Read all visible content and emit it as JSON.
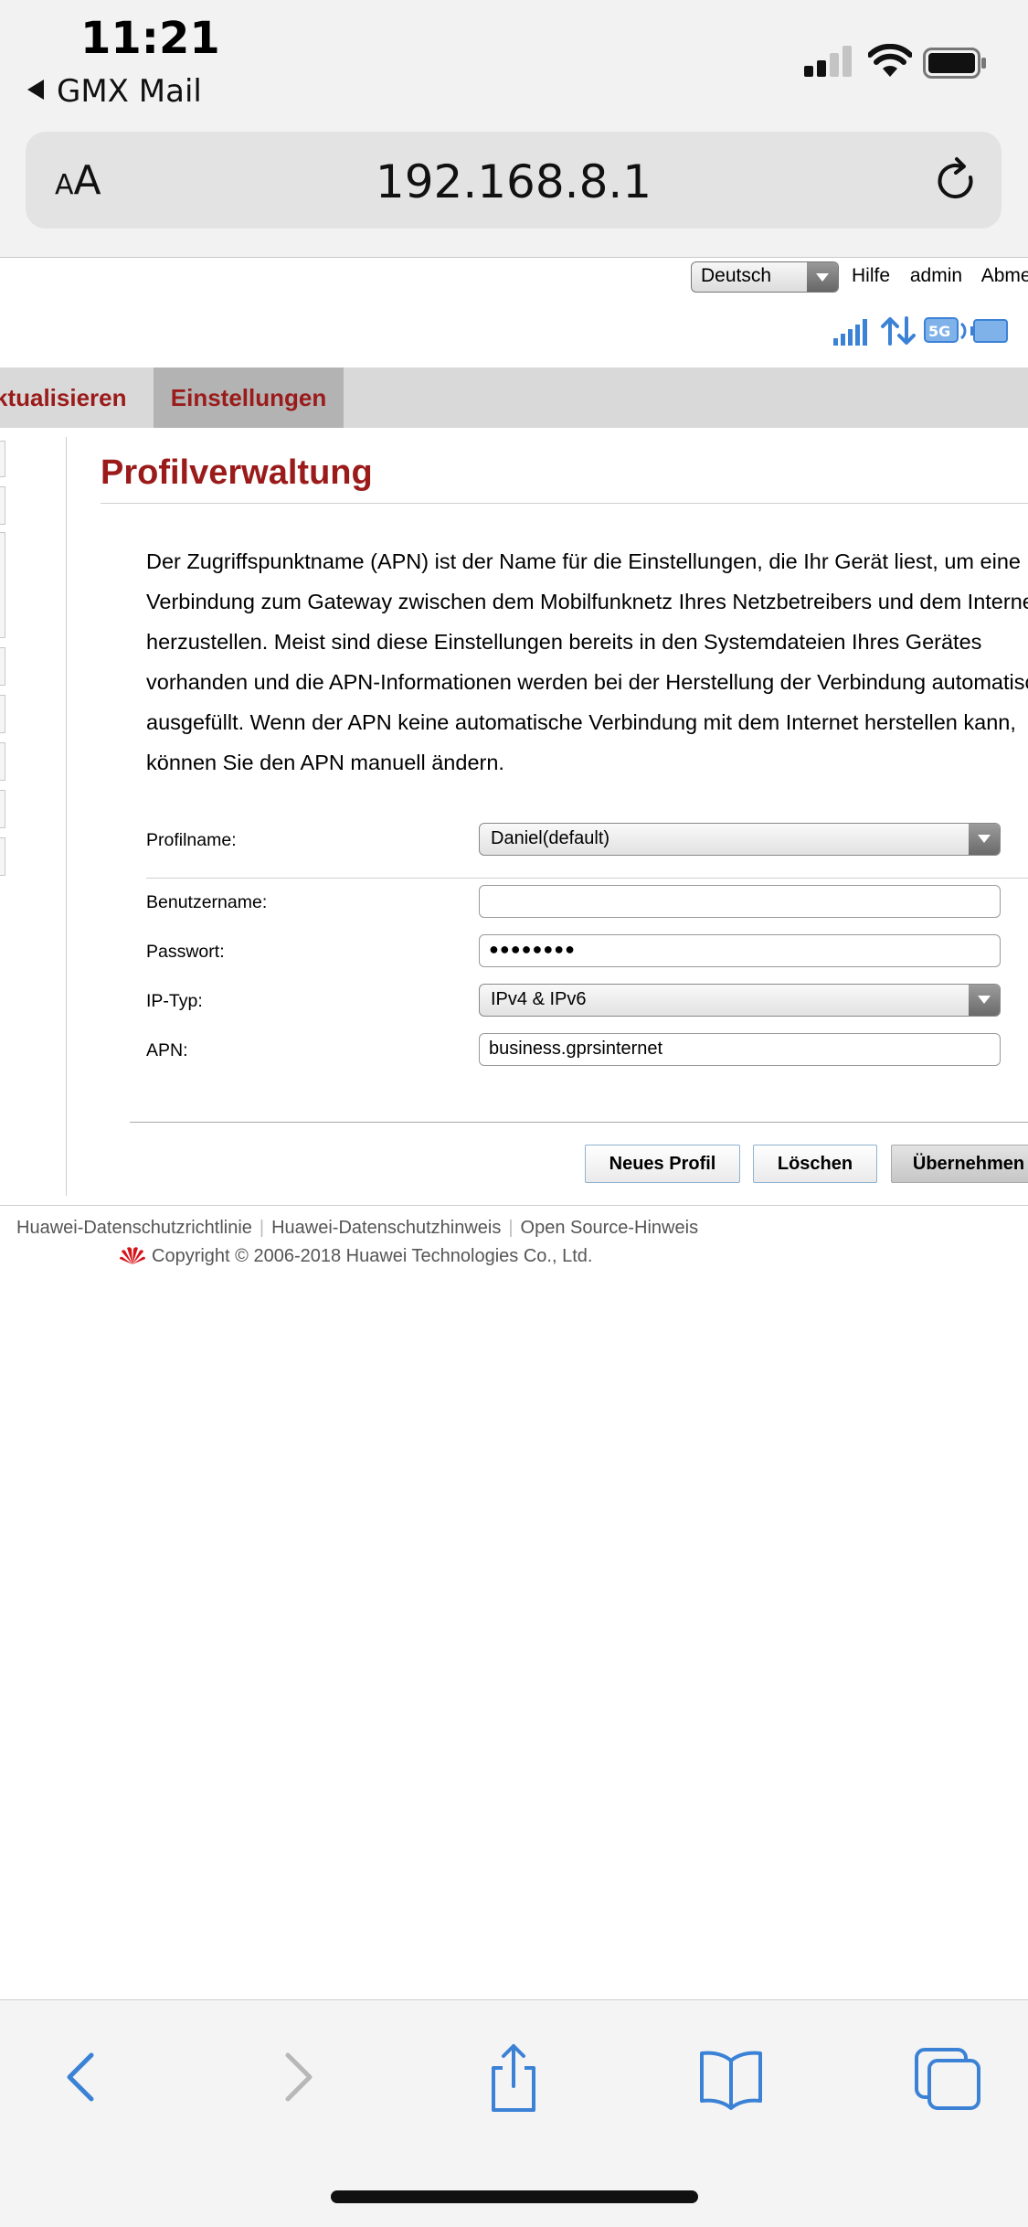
{
  "status_bar": {
    "time": "11:21",
    "back_app": "GMX Mail"
  },
  "safari": {
    "text_size_small": "A",
    "text_size_big": "A",
    "url": "192.168.8.1"
  },
  "router": {
    "language": "Deutsch",
    "top_links": [
      "Hilfe",
      "admin",
      "Abmeldung"
    ],
    "status_icons": [
      "signal-strength-icon",
      "data-transfer-icon",
      "5g-icon",
      "battery-icon"
    ],
    "menu": {
      "update": "ktualisieren",
      "settings": "Einstellungen"
    },
    "title": "Profilverwaltung",
    "description_lines": [
      "Der Zugriffspunktname (APN) ist der Name für die Einstellungen, die Ihr Gerät liest, um eine",
      "Verbindung zum Gateway zwischen dem Mobilfunknetz Ihres Netzbetreibers und dem Internet",
      "herzustellen. Meist sind diese Einstellungen bereits in den Systemdateien Ihres Gerätes",
      "vorhanden und die APN-Informationen werden bei der Herstellung der Verbindung automatisch",
      "ausgefüllt. Wenn der APN keine automatische Verbindung mit dem Internet herstellen kann,",
      "können Sie den APN manuell ändern."
    ],
    "form": {
      "profile_label": "Profilname:",
      "profile_value": "Daniel(default)",
      "username_label": "Benutzername:",
      "username_value": "",
      "password_label": "Passwort:",
      "password_value": "●●●●●●●●",
      "ip_type_label": "IP-Typ:",
      "ip_type_value": "IPv4 & IPv6",
      "apn_label": "APN:",
      "apn_value": "business.gprsinternet"
    },
    "buttons": {
      "new_profile": "Neues Profil",
      "delete": "Löschen",
      "apply": "Übernehmen"
    },
    "footer": {
      "links": [
        "Huawei-Datenschutzrichtlinie",
        "Huawei-Datenschutzhinweis",
        "Open Source-Hinweis"
      ],
      "copyright": "Copyright © 2006-2018 Huawei Technologies Co., Ltd."
    }
  },
  "colors": {
    "brand_red": "#9b1b1b",
    "ios_blue": "#3b82d6",
    "menu_bg": "#d9d9d9"
  }
}
